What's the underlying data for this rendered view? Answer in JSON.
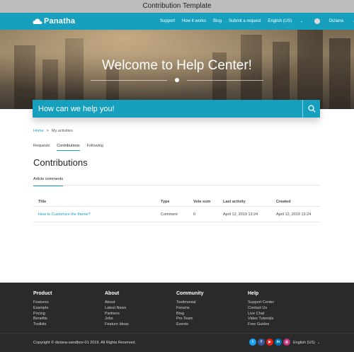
{
  "caption": "Contribution Template",
  "brand": {
    "name": "Panatha",
    "accent": "#17a0be"
  },
  "nav": {
    "links": [
      "Support",
      "How it works",
      "Blog",
      "Submit a request"
    ],
    "language": "English (US)",
    "user": "Diziana"
  },
  "hero": {
    "title": "Welcome to Help Center!"
  },
  "search": {
    "placeholder": "How can we help you!"
  },
  "breadcrumb": {
    "home": "Home",
    "separator": ">",
    "current": "My activities"
  },
  "subtabs": {
    "requests": "Requests",
    "contributions": "Contributions",
    "following": "Following"
  },
  "page_title": "Contributions",
  "filter_tab": "Article comments",
  "table": {
    "headers": {
      "title": "Title",
      "type": "Type",
      "vote_sum": "Vote sum",
      "last_activity": "Last activity",
      "created": "Created"
    },
    "rows": [
      {
        "title": "How to Customize the theme?",
        "type": "Comment",
        "vote_sum": "0",
        "last_activity": "April 12, 2019 13:24",
        "created": "April 12, 2019 13:24"
      }
    ]
  },
  "footer": {
    "columns": [
      {
        "title": "Product",
        "links": [
          "Features",
          "Example",
          "Pricing",
          "Benefits",
          "Toolkits"
        ]
      },
      {
        "title": "About",
        "links": [
          "About",
          "Latest News",
          "Partners",
          "Jobs",
          "Feature Ideas"
        ]
      },
      {
        "title": "Community",
        "links": [
          "Testimonial",
          "Forums",
          "Blog",
          "Pro Team",
          "Events"
        ]
      },
      {
        "title": "Help",
        "links": [
          "Support Center",
          "Contact Us",
          "Live Chat",
          "Video Tutorials",
          "Free Guides"
        ]
      }
    ],
    "copyright": "Copyright © diziana-sandbox-01 2019. All Rights Reserved.",
    "language": "English (US)",
    "socials": [
      {
        "icon": "twitter-icon",
        "glyph": "t",
        "color": "#1da1f2"
      },
      {
        "icon": "facebook-icon",
        "glyph": "f",
        "color": "#3b5998"
      },
      {
        "icon": "youtube-icon",
        "glyph": "▶",
        "color": "#e62117"
      },
      {
        "icon": "linkedin-icon",
        "glyph": "in",
        "color": "#0077b5"
      },
      {
        "icon": "instagram-icon",
        "glyph": "◎",
        "color": "#c13584"
      }
    ]
  }
}
